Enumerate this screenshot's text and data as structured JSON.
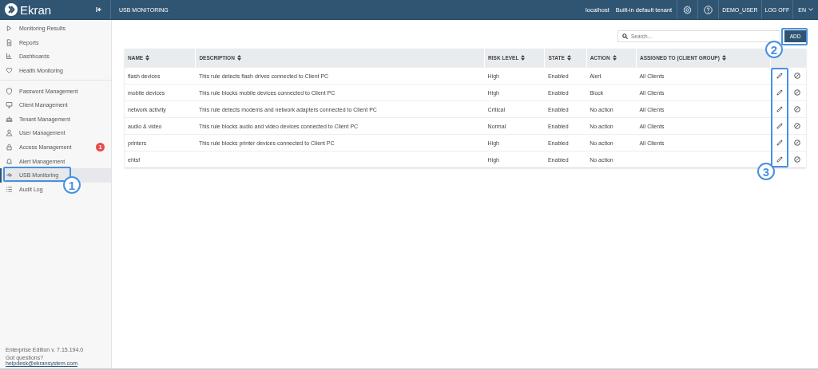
{
  "header": {
    "brand": "Ekran",
    "title": "USB MONITORING",
    "host": "localhost",
    "tenant": "Built-in default tenant",
    "user": "DEMO_USER",
    "logoff": "LOG OFF",
    "language": "EN"
  },
  "sidebar": {
    "groups": [
      [
        {
          "label": "Monitoring Results",
          "selected": false
        },
        {
          "label": "Reports",
          "selected": false
        },
        {
          "label": "Dashboards",
          "selected": false
        },
        {
          "label": "Health Monitoring",
          "selected": false
        }
      ],
      [
        {
          "label": "Password Management",
          "selected": false
        },
        {
          "label": "Client Management",
          "selected": false
        },
        {
          "label": "Tenant Management",
          "selected": false
        },
        {
          "label": "User Management",
          "selected": false
        },
        {
          "label": "Access Management",
          "selected": false,
          "badge": "1"
        },
        {
          "label": "Alert Management",
          "selected": false
        },
        {
          "label": "USB Monitoring",
          "selected": true
        },
        {
          "label": "Audit Log",
          "selected": false
        }
      ]
    ],
    "edition": "Enterprise Edition v. 7.15.194.0",
    "questions": "Got questions?",
    "email": "helpdesk@ekransystem.com"
  },
  "search": {
    "placeholder": "Search..."
  },
  "add_button": "ADD",
  "table": {
    "columns": [
      "NAME",
      "DESCRIPTION",
      "RISK LEVEL",
      "STATE",
      "ACTION",
      "ASSIGNED TO (CLIENT GROUP)"
    ],
    "rows": [
      {
        "name": "flash devices",
        "description": "This rule detects flash drives connected to Client PC",
        "risk": "High",
        "state": "Enabled",
        "action": "Alert",
        "assigned": "All Clients"
      },
      {
        "name": "mobile devices",
        "description": "This rule blocks mobile devices connected to Client PC",
        "risk": "High",
        "state": "Enabled",
        "action": "Block",
        "assigned": "All Clients"
      },
      {
        "name": "network activity",
        "description": "This rule detects modems and network adapters connected to Client PC",
        "risk": "Critical",
        "state": "Enabled",
        "action": "No action",
        "assigned": "All Clients"
      },
      {
        "name": "audio & video",
        "description": "This rule blocks audio and video devices connected to Client PC",
        "risk": "Normal",
        "state": "Enabled",
        "action": "No action",
        "assigned": "All Clients"
      },
      {
        "name": "printers",
        "description": "This rule blocks printer devices connected to Client PC",
        "risk": "High",
        "state": "Enabled",
        "action": "No action",
        "assigned": "All Clients"
      },
      {
        "name": "ehtsf",
        "risk": "High",
        "state": "Enabled",
        "action": "No action"
      }
    ]
  },
  "callouts": [
    "1",
    "2",
    "3"
  ]
}
